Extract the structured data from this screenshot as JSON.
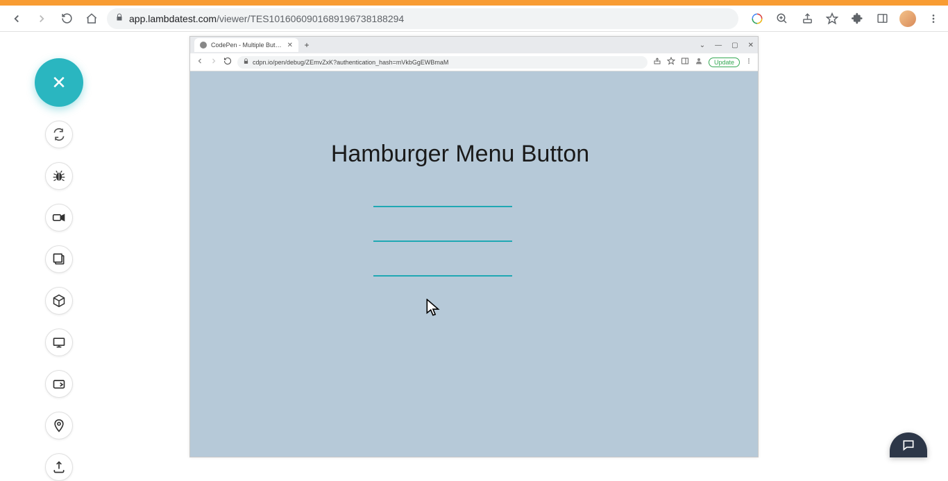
{
  "outer_browser": {
    "url_host": "app.lambdatest.com",
    "url_path": "/viewer/TES10160609016891967381​88294"
  },
  "lt_sidebar": {
    "close_label": "✕"
  },
  "remote_window": {
    "tab_title": "CodePen - Multiple Button Tran…",
    "url": "cdpn.io/pen/debug/ZEmvZxK?authentication_hash=mVkbGgEWBmaM",
    "update_label": "Update"
  },
  "demo": {
    "heading": "Hamburger Menu Button"
  }
}
